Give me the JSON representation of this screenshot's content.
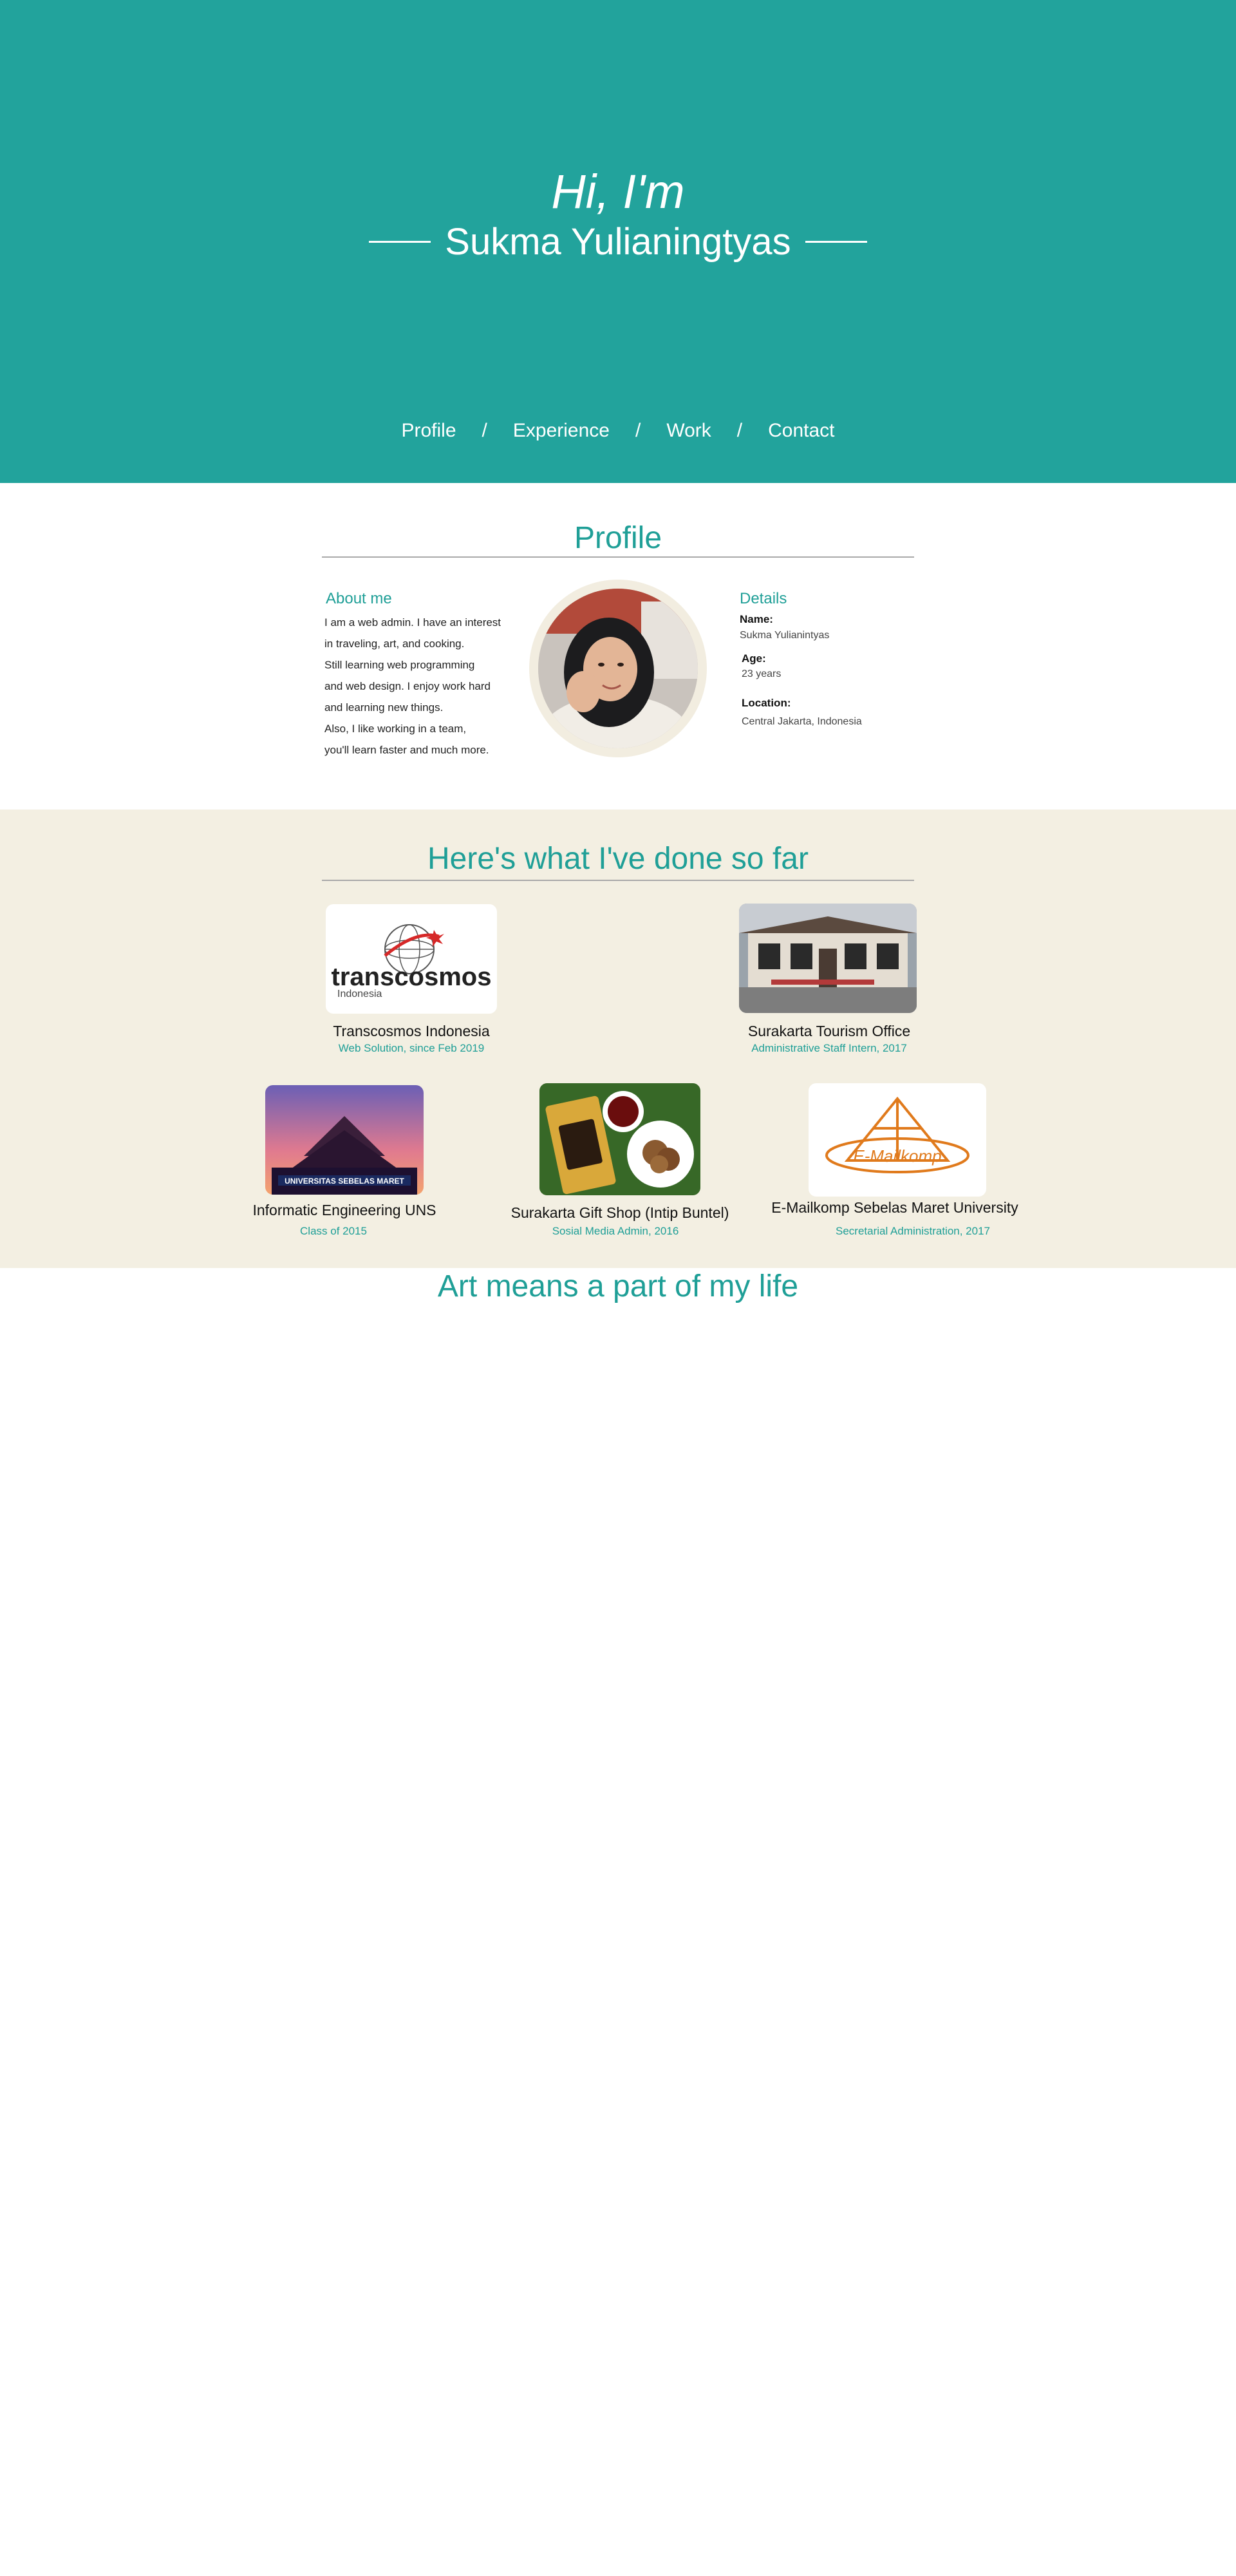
{
  "hero": {
    "greeting": "Hi, I'm",
    "name": "Sukma Yulianingtyas",
    "nav": [
      "Profile",
      "Experience",
      "Work",
      "Contact"
    ],
    "nav_separator": "/",
    "colors": {
      "background": "#22a39c",
      "text": "#ffffff"
    }
  },
  "profile": {
    "title": "Profile",
    "about": {
      "heading": "About me",
      "lines": [
        "I am a web admin. I have an interest",
        "in traveling, art, and cooking.",
        "Still learning web programming",
        "and web design. I enjoy work hard",
        "and learning new things.",
        "Also, I like working in a team,",
        "you'll learn faster and much more."
      ]
    },
    "details": {
      "heading": "Details",
      "name_label": "Name:",
      "name_value": "Sukma Yulianintyas",
      "age_label": "Age:",
      "age_value": "23 years",
      "location_label": "Location:",
      "location_value": "Central Jakarta, Indonesia"
    }
  },
  "experience": {
    "title": "Here's what I've done so far",
    "items": [
      {
        "title": "Transcosmos Indonesia",
        "subtitle": "Web Solution, since Feb 2019",
        "image": "transcosmos-logo",
        "logo_text": "transcosmos",
        "logo_sub": "Indonesia"
      },
      {
        "title": "Surakarta Tourism Office",
        "subtitle": "Administrative Staff Intern, 2017",
        "image": "building-photo"
      },
      {
        "title": "Informatic Engineering UNS",
        "subtitle": "Class of 2015",
        "image": "university-photo",
        "banner": "UNIVERSITAS SEBELAS MARET"
      },
      {
        "title": "Surakarta Gift Shop (Intip Buntel)",
        "subtitle": "Sosial Media Admin, 2016",
        "image": "food-photo"
      },
      {
        "title": "E-Mailkomp Sebelas Maret University",
        "subtitle": "Secretarial Administration, 2017",
        "image": "emailkomp-logo",
        "logo_text": "E-Mailkomp"
      }
    ],
    "colors": {
      "band": "#f3efe2",
      "accent": "#1f9f97"
    }
  },
  "work": {
    "title": "Art means a part of my life"
  }
}
